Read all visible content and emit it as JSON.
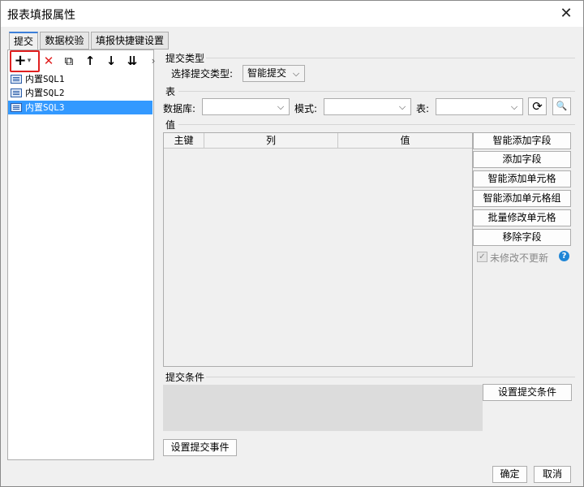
{
  "window": {
    "title": "报表填报属性",
    "close_icon": "close-icon"
  },
  "tabs": [
    {
      "label": "提交",
      "active": true
    },
    {
      "label": "数据校验",
      "active": false
    },
    {
      "label": "填报快捷键设置",
      "active": false
    }
  ],
  "toolbar": {
    "add_icon": "+",
    "add_dropdown": "▾",
    "delete_icon": "✕",
    "copy_icon": "⧉",
    "up_icon": "↑",
    "down_icon": "↓",
    "bottom_icon": "⇊",
    "more_icon": "›"
  },
  "sql_list": [
    {
      "label": "内置SQL1",
      "selected": false
    },
    {
      "label": "内置SQL2",
      "selected": false
    },
    {
      "label": "内置SQL3",
      "selected": true
    }
  ],
  "submit_type": {
    "group_title": "提交类型",
    "label": "选择提交类型:",
    "value": "智能提交"
  },
  "table": {
    "group_title": "表",
    "db_label": "数据库:",
    "db_value": "",
    "schema_label": "模式:",
    "schema_value": "",
    "table_label": "表:",
    "table_value": "",
    "refresh_icon": "⟳",
    "preview_icon": "🔍"
  },
  "values": {
    "group_title": "值",
    "columns": [
      "主键",
      "列",
      "值"
    ],
    "buttons": [
      "智能添加字段",
      "添加字段",
      "智能添加单元格",
      "智能添加单元格组",
      "批量修改单元格",
      "移除字段"
    ],
    "unchanged_label": "未修改不更新",
    "unchanged_checked": true,
    "help_icon": "?"
  },
  "condition": {
    "group_title": "提交条件",
    "button": "设置提交条件"
  },
  "event_button": "设置提交事件",
  "footer": {
    "ok": "确定",
    "cancel": "取消"
  },
  "colors": {
    "selection": "#3399ff",
    "highlight": "#e02020",
    "help": "#1f86d6"
  }
}
